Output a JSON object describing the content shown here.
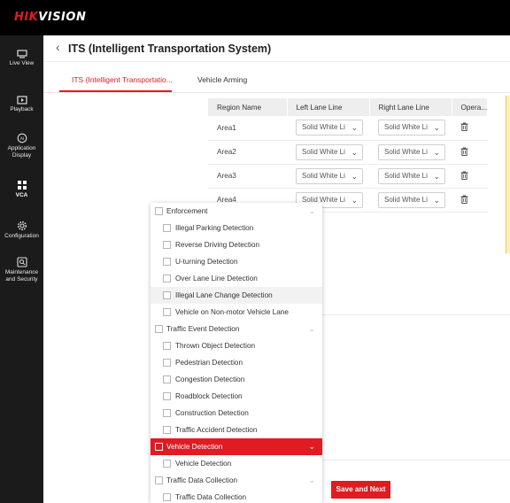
{
  "brand": {
    "part1": "HIK",
    "part2": "VISION"
  },
  "sidebar": {
    "items": [
      {
        "label": "Live View",
        "icon": "monitor-icon"
      },
      {
        "label": "Playback",
        "icon": "play-icon"
      },
      {
        "label": "Application Display",
        "icon": "ai-icon"
      },
      {
        "label": "VCA",
        "icon": "grid-icon"
      },
      {
        "label": "Configuration",
        "icon": "gear-icon"
      },
      {
        "label": "Maintenance and Security",
        "icon": "shield-search-icon"
      }
    ]
  },
  "header": {
    "title": "ITS (Intelligent Transportation System)"
  },
  "tabs": [
    "ITS (Intelligent Transportatio...",
    "Vehicle Arming"
  ],
  "table": {
    "headers": [
      "Region Name",
      "Left Lane Line",
      "Right Lane Line",
      "Opera..."
    ],
    "rows": [
      {
        "name": "Area1",
        "left": "Solid White Li",
        "right": "Solid White Li"
      },
      {
        "name": "Area2",
        "left": "Solid White Li",
        "right": "Solid White Li"
      },
      {
        "name": "Area3",
        "left": "Solid White Li",
        "right": "Solid White Li"
      },
      {
        "name": "Area4",
        "left": "Solid White Li",
        "right": "Solid White Li"
      }
    ]
  },
  "dropdown": {
    "items": [
      {
        "label": "Enforcement",
        "group": true
      },
      {
        "label": "Illegal Parking Detection",
        "group": false
      },
      {
        "label": "Reverse Driving Detection",
        "group": false
      },
      {
        "label": "U-turning Detection",
        "group": false
      },
      {
        "label": "Over Lane Line Detection",
        "group": false
      },
      {
        "label": "Illegal Lane Change Detection",
        "group": false
      },
      {
        "label": "Vehicle on Non-motor Vehicle Lane",
        "group": false
      },
      {
        "label": "Traffic Event Detection",
        "group": true
      },
      {
        "label": "Thrown Object Detection",
        "group": false
      },
      {
        "label": "Pedestrian Detection",
        "group": false
      },
      {
        "label": "Congestion Detection",
        "group": false
      },
      {
        "label": "Roadblock Detection",
        "group": false
      },
      {
        "label": "Construction Detection",
        "group": false
      },
      {
        "label": "Traffic Accident Detection",
        "group": false
      },
      {
        "label": "Vehicle Detection",
        "group": true,
        "highlighted": true
      },
      {
        "label": "Vehicle Detection",
        "group": false
      },
      {
        "label": "Traffic Data Collection",
        "group": true
      },
      {
        "label": "Traffic Data Collection",
        "group": false
      }
    ]
  },
  "actions": {
    "save_next": "Save and Next"
  },
  "colors": {
    "accent": "#e01b22",
    "topbar": "#000000",
    "sidebar": "#1b1b1b"
  }
}
